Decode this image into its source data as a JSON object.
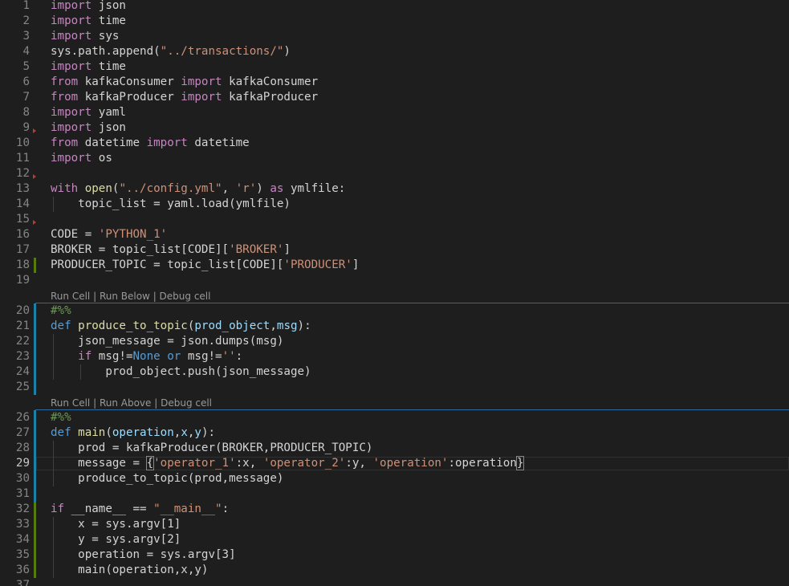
{
  "editor": {
    "colors": {
      "background": "#1e1e1e",
      "keyword_control": "#c586c0",
      "keyword_storage": "#569cd6",
      "function": "#dcdcaa",
      "string": "#ce9178",
      "parameter": "#9cdcfe",
      "comment": "#6a9955",
      "text": "#d4d4d4",
      "line_number": "#858585",
      "cell_border": "#2b6a9e",
      "git_modified": "#1b81a8",
      "git_added": "#587c0c"
    },
    "codelens": [
      {
        "run": "Run Cell",
        "second": "Run Below",
        "debug": "Debug cell"
      },
      {
        "run": "Run Cell",
        "second": "Run Above",
        "debug": "Debug cell"
      }
    ],
    "lines": [
      {
        "n": "1",
        "tokens": [
          [
            "kw",
            "import"
          ],
          [
            "tx",
            " json"
          ]
        ]
      },
      {
        "n": "2",
        "tokens": [
          [
            "kw",
            "import"
          ],
          [
            "tx",
            " time"
          ]
        ]
      },
      {
        "n": "3",
        "tokens": [
          [
            "kw",
            "import"
          ],
          [
            "tx",
            " sys"
          ]
        ]
      },
      {
        "n": "4",
        "tokens": [
          [
            "tx",
            "sys.path.append("
          ],
          [
            "st",
            "\"../transactions/\""
          ],
          [
            "tx",
            ")"
          ]
        ]
      },
      {
        "n": "5",
        "tokens": [
          [
            "kw",
            "import"
          ],
          [
            "tx",
            " time"
          ]
        ]
      },
      {
        "n": "6",
        "tokens": [
          [
            "kw",
            "from"
          ],
          [
            "tx",
            " kafkaConsumer "
          ],
          [
            "kw",
            "import"
          ],
          [
            "tx",
            " kafkaConsumer"
          ]
        ]
      },
      {
        "n": "7",
        "tokens": [
          [
            "kw",
            "from"
          ],
          [
            "tx",
            " kafkaProducer "
          ],
          [
            "kw",
            "import"
          ],
          [
            "tx",
            " kafkaProducer"
          ]
        ]
      },
      {
        "n": "8",
        "tokens": [
          [
            "kw",
            "import"
          ],
          [
            "tx",
            " yaml"
          ]
        ]
      },
      {
        "n": "9",
        "tokens": [
          [
            "kw",
            "import"
          ],
          [
            "tx",
            " json"
          ]
        ]
      },
      {
        "n": "10",
        "tokens": [
          [
            "kw",
            "from"
          ],
          [
            "tx",
            " datetime "
          ],
          [
            "kw",
            "import"
          ],
          [
            "tx",
            " datetime"
          ]
        ]
      },
      {
        "n": "11",
        "tokens": [
          [
            "kw",
            "import"
          ],
          [
            "tx",
            " os"
          ]
        ]
      },
      {
        "n": "12",
        "tokens": []
      },
      {
        "n": "13",
        "tokens": [
          [
            "kw",
            "with"
          ],
          [
            "tx",
            " "
          ],
          [
            "fn",
            "open"
          ],
          [
            "tx",
            "("
          ],
          [
            "st",
            "\"../config.yml\""
          ],
          [
            "tx",
            ", "
          ],
          [
            "st",
            "'r'"
          ],
          [
            "tx",
            ") "
          ],
          [
            "kw",
            "as"
          ],
          [
            "tx",
            " ymlfile:"
          ]
        ]
      },
      {
        "n": "14",
        "tokens": [
          [
            "tx",
            "    topic_list = yaml.load(ymlfile)"
          ]
        ]
      },
      {
        "n": "15",
        "tokens": []
      },
      {
        "n": "16",
        "tokens": [
          [
            "tx",
            "CODE = "
          ],
          [
            "st",
            "'PYTHON_1'"
          ]
        ]
      },
      {
        "n": "17",
        "tokens": [
          [
            "tx",
            "BROKER = topic_list[CODE]["
          ],
          [
            "st",
            "'BROKER'"
          ],
          [
            "tx",
            "]"
          ]
        ]
      },
      {
        "n": "18",
        "tokens": [
          [
            "tx",
            "PRODUCER_TOPIC = topic_list[CODE]["
          ],
          [
            "st",
            "'PRODUCER'"
          ],
          [
            "tx",
            "]"
          ]
        ]
      },
      {
        "n": "19",
        "tokens": []
      },
      {
        "n": "20",
        "tokens": [
          [
            "cm",
            "#%%"
          ]
        ]
      },
      {
        "n": "21",
        "tokens": [
          [
            "kb",
            "def"
          ],
          [
            "tx",
            " "
          ],
          [
            "fn",
            "produce_to_topic"
          ],
          [
            "tx",
            "("
          ],
          [
            "pm",
            "prod_object"
          ],
          [
            "tx",
            ","
          ],
          [
            "pm",
            "msg"
          ],
          [
            "tx",
            "):"
          ]
        ]
      },
      {
        "n": "22",
        "tokens": [
          [
            "tx",
            "    json_message = json.dumps(msg)"
          ]
        ]
      },
      {
        "n": "23",
        "tokens": [
          [
            "tx",
            "    "
          ],
          [
            "kw",
            "if"
          ],
          [
            "tx",
            " msg!="
          ],
          [
            "kb",
            "None"
          ],
          [
            "tx",
            " "
          ],
          [
            "kb",
            "or"
          ],
          [
            "tx",
            " msg!="
          ],
          [
            "st",
            "''"
          ],
          [
            "tx",
            ":"
          ]
        ]
      },
      {
        "n": "24",
        "tokens": [
          [
            "tx",
            "        prod_object.push(json_message)"
          ]
        ]
      },
      {
        "n": "25",
        "tokens": []
      },
      {
        "n": "26",
        "tokens": [
          [
            "cm",
            "#%%"
          ]
        ]
      },
      {
        "n": "27",
        "tokens": [
          [
            "kb",
            "def"
          ],
          [
            "tx",
            " "
          ],
          [
            "fn",
            "main"
          ],
          [
            "tx",
            "("
          ],
          [
            "pm",
            "operation"
          ],
          [
            "tx",
            ","
          ],
          [
            "pm",
            "x"
          ],
          [
            "tx",
            ","
          ],
          [
            "pm",
            "y"
          ],
          [
            "tx",
            "):"
          ]
        ]
      },
      {
        "n": "28",
        "tokens": [
          [
            "tx",
            "    prod = kafkaProducer(BROKER,PRODUCER_TOPIC)"
          ]
        ]
      },
      {
        "n": "29",
        "tokens": [
          [
            "tx",
            "    message = "
          ],
          [
            "br",
            "{"
          ],
          [
            "st",
            "'operator_1'"
          ],
          [
            "tx",
            ":x, "
          ],
          [
            "st",
            "'operator_2'"
          ],
          [
            "tx",
            ":y, "
          ],
          [
            "st",
            "'operation'"
          ],
          [
            "tx",
            ":operation"
          ],
          [
            "br",
            "}"
          ]
        ]
      },
      {
        "n": "30",
        "tokens": [
          [
            "tx",
            "    produce_to_topic(prod,message)"
          ]
        ]
      },
      {
        "n": "31",
        "tokens": []
      },
      {
        "n": "32",
        "tokens": [
          [
            "kw",
            "if"
          ],
          [
            "tx",
            " __name__ == "
          ],
          [
            "st",
            "\"__main__\""
          ],
          [
            "tx",
            ":"
          ]
        ]
      },
      {
        "n": "33",
        "tokens": [
          [
            "tx",
            "    x = sys.argv[1]"
          ]
        ]
      },
      {
        "n": "34",
        "tokens": [
          [
            "tx",
            "    y = sys.argv[2]"
          ]
        ]
      },
      {
        "n": "35",
        "tokens": [
          [
            "tx",
            "    operation = sys.argv[3]"
          ]
        ]
      },
      {
        "n": "36",
        "tokens": [
          [
            "tx",
            "    main(operation,x,y)"
          ]
        ]
      },
      {
        "n": "37",
        "tokens": []
      }
    ]
  }
}
